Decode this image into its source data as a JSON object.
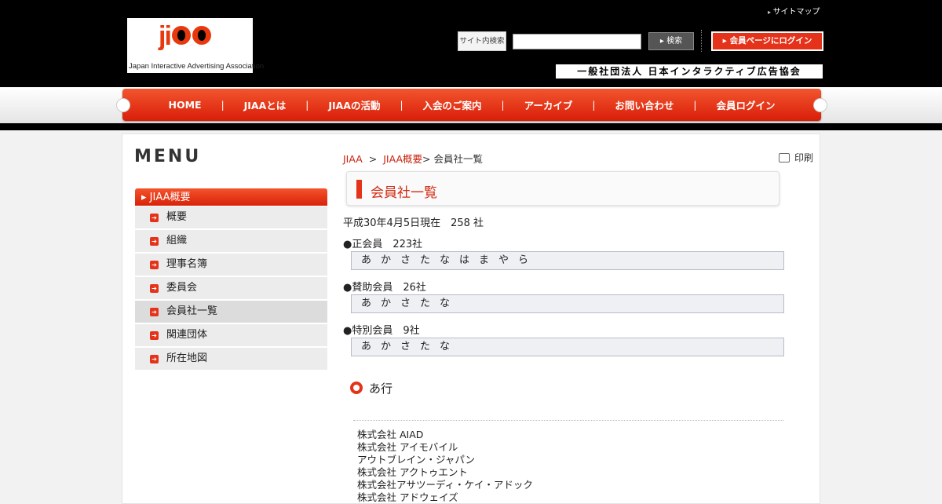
{
  "header": {
    "logo_mark": "ji",
    "logo_tagline": "Japan Interactive Advertising Association",
    "sitemap_link": "サイトマップ",
    "search_label": "サイト内検索",
    "search_value": "",
    "search_button": "▸ 検索",
    "login_button": "▸ 会員ページにログイン",
    "org_name": "一般社団法人 日本インタラクティブ広告協会"
  },
  "nav": {
    "items": [
      "HOME",
      "JIAAとは",
      "JIAAの活動",
      "入会のご案内",
      "アーカイブ",
      "お問い合わせ",
      "会員ログイン"
    ],
    "separator": "|"
  },
  "sidebar": {
    "menu_title": "MENU",
    "section_label": "JIAA概要",
    "items": [
      {
        "label": "概要"
      },
      {
        "label": "組織"
      },
      {
        "label": "理事名簿"
      },
      {
        "label": "委員会"
      },
      {
        "label": "会員社一覧"
      },
      {
        "label": "関連団体"
      },
      {
        "label": "所在地図"
      }
    ]
  },
  "breadcrumb": {
    "home": "JIAA",
    "sep1": ">",
    "section": "JIAA概要",
    "current": "> 会員社一覧"
  },
  "print_label": "印刷",
  "page_title": "会員社一覧",
  "main": {
    "summary": "平成30年4月5日現在　258 社",
    "group1_label": "●正会員　223社",
    "group1_index": "あかさたなはまやら",
    "group2_label": "●賛助会員　26社",
    "group2_index": "あかさたな",
    "group3_label": "●特別会員　9社",
    "group3_index": "あかさたな",
    "section_title": "あ行",
    "list": [
      "株式会社 AIAD",
      "株式会社 アイモバイル",
      "アウトブレイン・ジャパン",
      "株式会社 アクトゥエント",
      "株式会社アサツーディ・ケイ・アドック",
      "株式会社 アドウェイズ"
    ]
  },
  "colors": {
    "accent": "#e4331a",
    "link": "#c9230f",
    "header_bg": "#000000"
  },
  "icons": [
    "search-icon",
    "arrow-right-icon",
    "print-icon",
    "ring-bullet-icon"
  ]
}
